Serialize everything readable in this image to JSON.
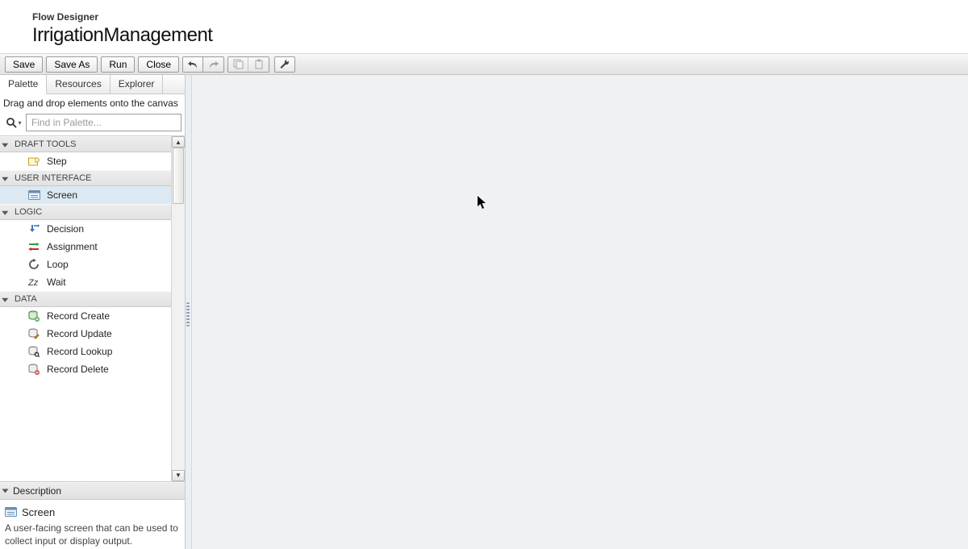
{
  "header": {
    "app": "Flow Designer",
    "title": "IrrigationManagement"
  },
  "toolbar": {
    "save": "Save",
    "save_as": "Save As",
    "run": "Run",
    "close": "Close"
  },
  "sidebar": {
    "tabs": {
      "palette": "Palette",
      "resources": "Resources",
      "explorer": "Explorer"
    },
    "hint": "Drag and drop elements onto the canvas",
    "search_placeholder": "Find in Palette...",
    "categories": {
      "draft_tools": {
        "label": "DRAFT TOOLS",
        "items": {
          "step": "Step"
        }
      },
      "user_interface": {
        "label": "USER INTERFACE",
        "items": {
          "screen": "Screen"
        }
      },
      "logic": {
        "label": "LOGIC",
        "items": {
          "decision": "Decision",
          "assignment": "Assignment",
          "loop": "Loop",
          "wait": "Wait"
        }
      },
      "data": {
        "label": "DATA",
        "items": {
          "record_create": "Record Create",
          "record_update": "Record Update",
          "record_lookup": "Record Lookup",
          "record_delete": "Record Delete"
        }
      }
    },
    "description": {
      "header": "Description",
      "title": "Screen",
      "text": "A user-facing screen that can be used to collect input or display output."
    }
  }
}
